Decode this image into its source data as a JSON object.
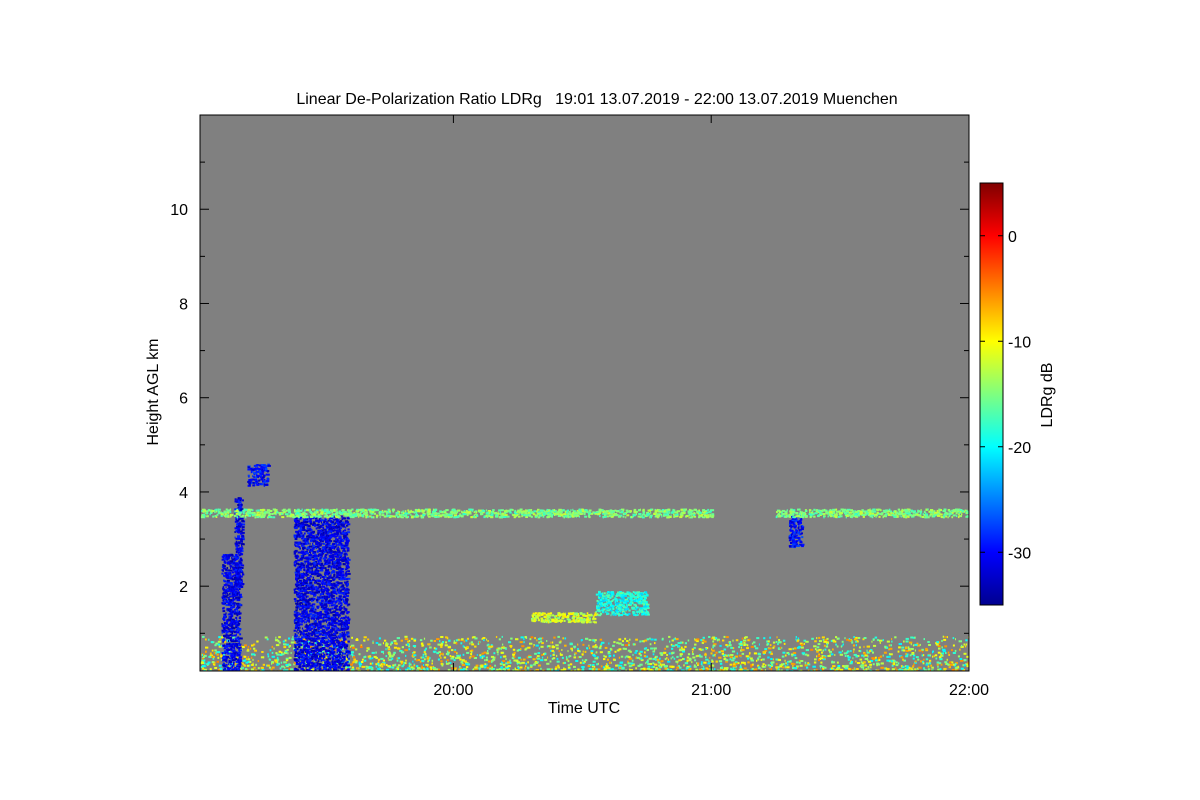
{
  "chart_data": {
    "type": "heatmap",
    "title": "Linear De-Polarization Ratio LDRg   19:01 13.07.2019 - 22:00 13.07.2019 Muenchen",
    "xlabel": "Time UTC",
    "ylabel": "Height AGL km",
    "x_ticks": [
      {
        "value": 20.0,
        "label": "20:00"
      },
      {
        "value": 21.0,
        "label": "21:00"
      },
      {
        "value": 22.0,
        "label": "22:00"
      }
    ],
    "y_ticks": [
      {
        "value": 2,
        "label": "2"
      },
      {
        "value": 4,
        "label": "4"
      },
      {
        "value": 6,
        "label": "6"
      },
      {
        "value": 8,
        "label": "8"
      },
      {
        "value": 10,
        "label": "10"
      }
    ],
    "xlim": [
      19.017,
      22.0
    ],
    "ylim": [
      0.2,
      12.0
    ],
    "no_signal_color": "#808080",
    "colorbar": {
      "label": "LDRg dB",
      "range": [
        -35,
        5
      ],
      "ticks": [
        {
          "value": 0,
          "label": "0"
        },
        {
          "value": -10,
          "label": "-10"
        },
        {
          "value": -20,
          "label": "-20"
        },
        {
          "value": -30,
          "label": "-30"
        }
      ],
      "colormap": [
        "#00008f",
        "#0000ff",
        "#00ffff",
        "#ffff00",
        "#ff0000",
        "#800000"
      ]
    },
    "features": [
      {
        "t0": 19.02,
        "t1": 22.0,
        "h0": 0.2,
        "h1": 0.95,
        "ldr": -13,
        "note": "boundary layer"
      },
      {
        "t0": 19.1,
        "t1": 19.17,
        "h0": 0.2,
        "h1": 2.7,
        "ldr": -31
      },
      {
        "t0": 19.15,
        "t1": 19.18,
        "h0": 2.0,
        "h1": 3.9,
        "ldr": -31
      },
      {
        "t0": 19.38,
        "t1": 19.59,
        "h0": 0.2,
        "h1": 3.5,
        "ldr": -31
      },
      {
        "t0": 19.2,
        "t1": 19.28,
        "h0": 4.15,
        "h1": 4.6,
        "ldr": -30
      },
      {
        "t0": 21.3,
        "t1": 21.35,
        "h0": 2.85,
        "h1": 3.5,
        "ldr": -30
      },
      {
        "t0": 19.02,
        "t1": 21.0,
        "h0": 3.48,
        "h1": 3.65,
        "ldr": -15
      },
      {
        "t0": 21.25,
        "t1": 22.0,
        "h0": 3.48,
        "h1": 3.65,
        "ldr": -15
      },
      {
        "t0": 20.55,
        "t1": 20.75,
        "h0": 1.4,
        "h1": 1.9,
        "ldr": -19
      },
      {
        "t0": 20.3,
        "t1": 20.55,
        "h0": 1.25,
        "h1": 1.45,
        "ldr": -12
      }
    ]
  }
}
